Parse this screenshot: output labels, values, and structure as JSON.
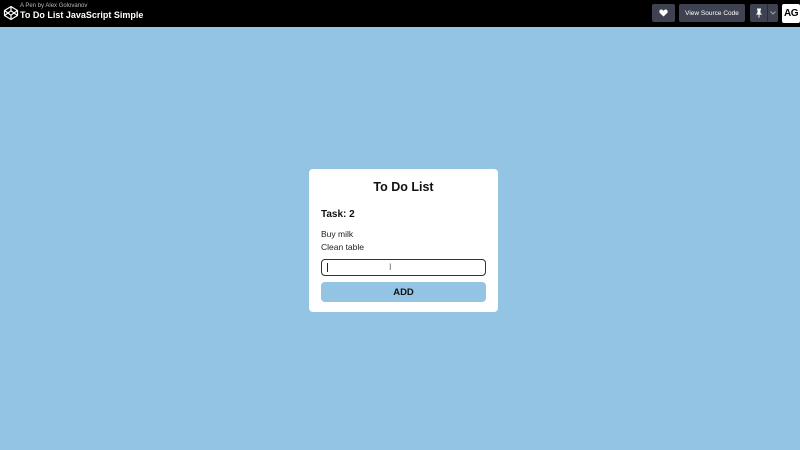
{
  "header": {
    "by_line": "A Pen by Alex Golovanov",
    "pen_title": "To Do List JavaScript Simple",
    "view_source_label": "View Source Code",
    "avatar_initials": "AG",
    "icons": {
      "logo": "codepen-logo-icon",
      "heart": "heart-icon",
      "pin": "pin-icon",
      "chevron": "chevron-down-icon"
    }
  },
  "app": {
    "title": "To Do List",
    "task_heading": "Task: 2",
    "tasks": [
      "Buy milk",
      "Clean table"
    ],
    "input_value": "",
    "input_placeholder": "",
    "add_label": "ADD"
  },
  "colors": {
    "background": "#94c4e4",
    "topbar": "#000000",
    "button_dark": "#3f4351",
    "card": "#ffffff",
    "add_button": "#94c4e4"
  }
}
